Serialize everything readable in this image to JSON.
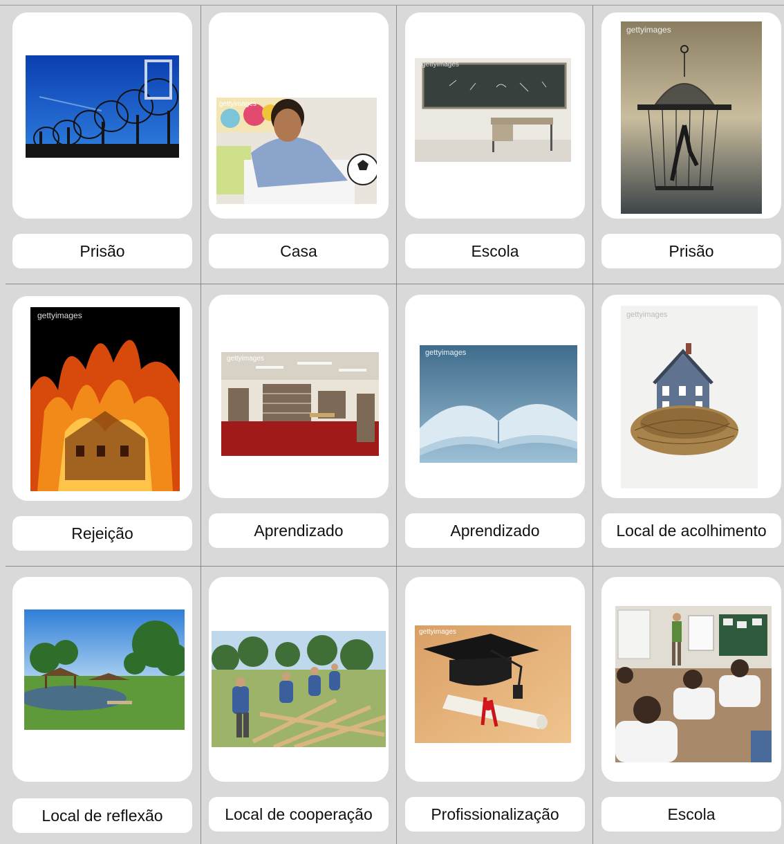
{
  "cards": [
    {
      "label": "Prisão",
      "image": "barbed-wire-fence",
      "watermark": ""
    },
    {
      "label": "Casa",
      "image": "boy-studying-on-bed",
      "watermark": "gettyimages"
    },
    {
      "label": "Escola",
      "image": "empty-classroom-chalkboard",
      "watermark": "gettyimages"
    },
    {
      "label": "Prisão",
      "image": "man-in-birdcage",
      "watermark": "gettyimages"
    },
    {
      "label": "Rejeição",
      "image": "house-on-fire",
      "watermark": "gettyimages"
    },
    {
      "label": "Aprendizado",
      "image": "library-interior",
      "watermark": "gettyimages"
    },
    {
      "label": "Aprendizado",
      "image": "open-book",
      "watermark": "gettyimages"
    },
    {
      "label": "Local de acolhimento",
      "image": "house-in-nest",
      "watermark": "gettyimages"
    },
    {
      "label": "Local de reflexão",
      "image": "pond-with-gazebo",
      "watermark": ""
    },
    {
      "label": "Local de cooperação",
      "image": "people-building-frame",
      "watermark": ""
    },
    {
      "label": "Profissionalização",
      "image": "graduation-cap-diploma",
      "watermark": "gettyimages"
    },
    {
      "label": "Escola",
      "image": "students-in-classroom",
      "watermark": ""
    }
  ]
}
